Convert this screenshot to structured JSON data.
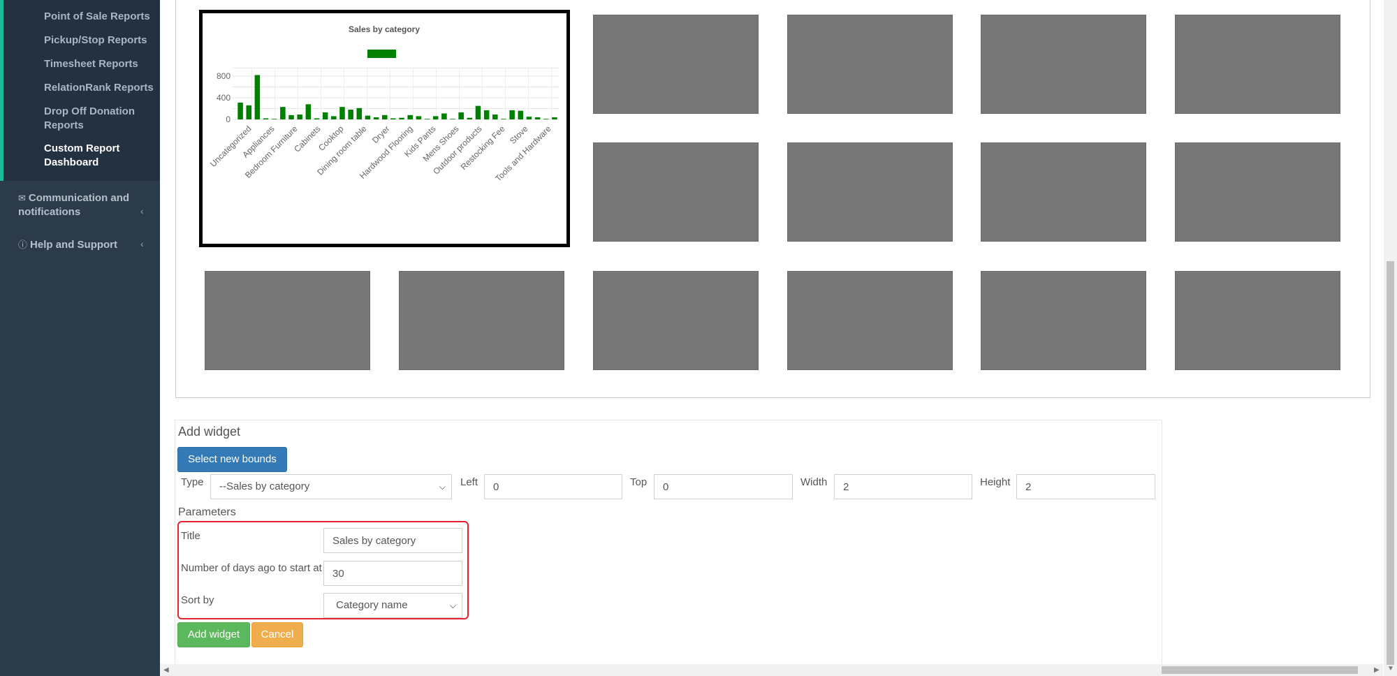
{
  "sidebar": {
    "submenu": [
      {
        "label": "Point of Sale Reports"
      },
      {
        "label": "Pickup/Stop Reports"
      },
      {
        "label": "Timesheet Reports"
      },
      {
        "label": "RelationRank Reports"
      },
      {
        "label": "Drop Off Donation",
        "label2": "Reports"
      },
      {
        "label": "Custom Report",
        "label2": "Dashboard",
        "active": true
      }
    ],
    "menu": [
      {
        "icon": "envelope-icon",
        "label": "Communication and",
        "label2": "notifications"
      },
      {
        "icon": "question-circle-icon",
        "label": "Help and Support"
      }
    ]
  },
  "chart_data": {
    "type": "bar",
    "title": "Sales by category",
    "legend_position": "top",
    "series_color": "#008000",
    "ylim": [
      0,
      1000
    ],
    "yticks": [
      0,
      400,
      800
    ],
    "grid": true,
    "tick_labels": [
      "Uncategorized",
      "Appliances",
      "Bedroom Furniture",
      "Cabinets",
      "Cooktop",
      "Dining room table",
      "Dryer",
      "Hardwood Flooring",
      "Kids Pants",
      "Mens Shoes",
      "Outdoor products",
      "Restocking Fee",
      "Stove",
      "Tools and Hardware"
    ],
    "values": [
      310,
      260,
      820,
      20,
      10,
      230,
      80,
      90,
      280,
      20,
      130,
      60,
      230,
      180,
      210,
      70,
      40,
      80,
      20,
      30,
      80,
      60,
      10,
      60,
      110,
      10,
      130,
      30,
      250,
      170,
      90,
      10,
      170,
      160,
      50,
      40,
      10,
      40
    ]
  },
  "form": {
    "heading": "Add widget",
    "select_bounds_label": "Select new bounds",
    "type_label": "Type",
    "type_value": "--Sales by category",
    "left_label": "Left",
    "left_value": "0",
    "top_label": "Top",
    "top_value": "0",
    "width_label": "Width",
    "width_value": "2",
    "height_label": "Height",
    "height_value": "2",
    "parameters_label": "Parameters",
    "params": {
      "title_label": "Title",
      "title_value": "Sales by category",
      "days_label": "Number of days ago to start at",
      "days_value": "30",
      "sort_label": "Sort by",
      "sort_value": "Category name"
    },
    "add_label": "Add widget",
    "cancel_label": "Cancel"
  },
  "colors": {
    "sidebar_bg": "#2c3b4a",
    "accent": "#1abb9c",
    "btn_primary": "#337ab7",
    "btn_success": "#5cb85c",
    "btn_warning": "#f0ad4e",
    "highlight": "#e8232f",
    "placeholder_cell": "#777777"
  }
}
